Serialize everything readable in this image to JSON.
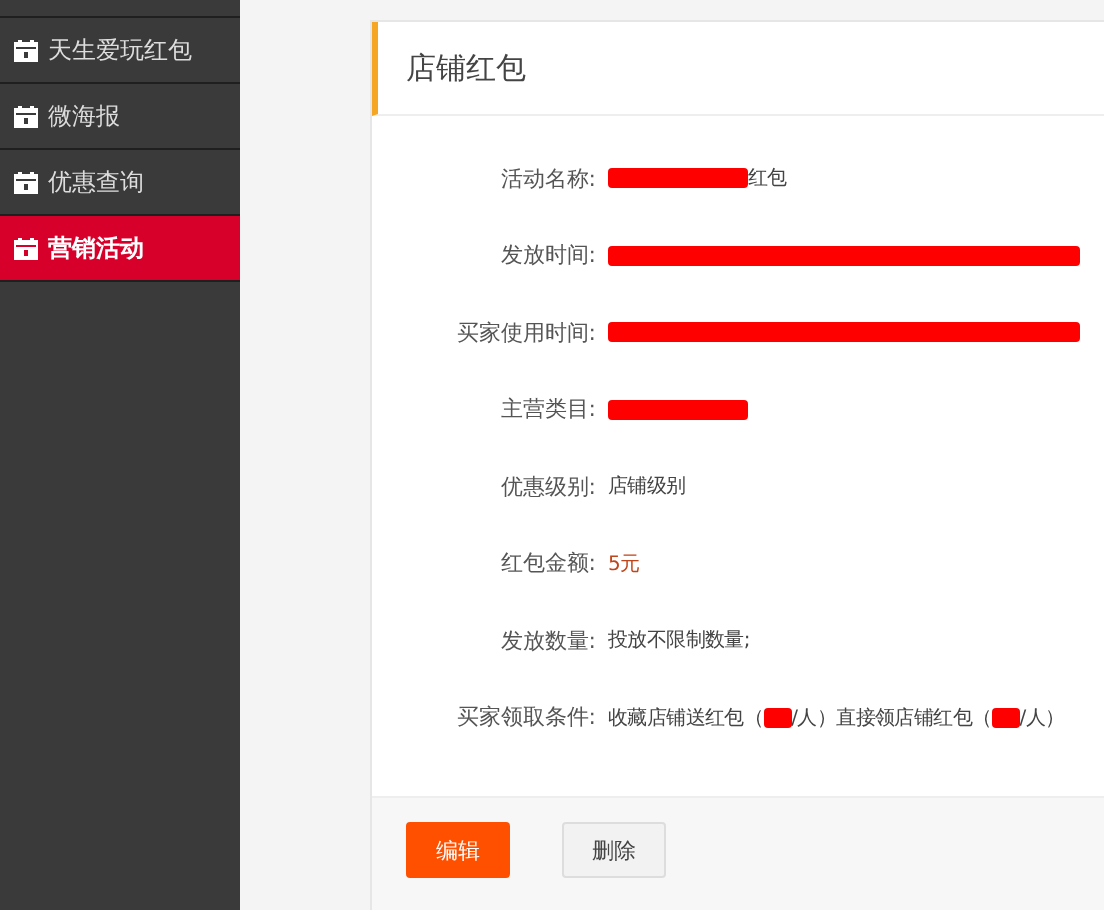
{
  "sidebar": {
    "items": [
      {
        "label": "天生爱玩红包",
        "selected": false
      },
      {
        "label": "微海报",
        "selected": false
      },
      {
        "label": "优惠查询",
        "selected": false
      },
      {
        "label": "营销活动",
        "selected": true
      }
    ]
  },
  "panel": {
    "title": "店铺红包",
    "fields": [
      {
        "label": "活动名称:",
        "parts": [
          {
            "kind": "redaction"
          },
          {
            "kind": "text",
            "text": "红包"
          }
        ]
      },
      {
        "label": "发放时间:",
        "parts": [
          {
            "kind": "redaction"
          }
        ]
      },
      {
        "label": "买家使用时间:",
        "parts": [
          {
            "kind": "redaction"
          }
        ]
      },
      {
        "label": "主营类目:",
        "parts": [
          {
            "kind": "redaction"
          }
        ]
      },
      {
        "label": "优惠级别:",
        "parts": [
          {
            "kind": "text",
            "text": "店铺级别"
          }
        ]
      },
      {
        "label": "红包金额:",
        "parts": [
          {
            "kind": "amount",
            "text": "5元"
          }
        ]
      },
      {
        "label": "发放数量:",
        "parts": [
          {
            "kind": "text",
            "text": "投放不限制数量;"
          }
        ]
      },
      {
        "label": "买家领取条件:",
        "parts": [
          {
            "kind": "text",
            "text": "收藏店铺送红包（"
          },
          {
            "kind": "redaction"
          },
          {
            "kind": "text",
            "text": "/人）"
          },
          {
            "kind": "text",
            "text": "直接领店铺红包（"
          },
          {
            "kind": "redaction"
          },
          {
            "kind": "text",
            "text": "/人）"
          }
        ]
      }
    ]
  },
  "buttons": [
    {
      "label": "编辑",
      "kind": "primary"
    },
    {
      "label": "删除",
      "kind": "default"
    }
  ]
}
